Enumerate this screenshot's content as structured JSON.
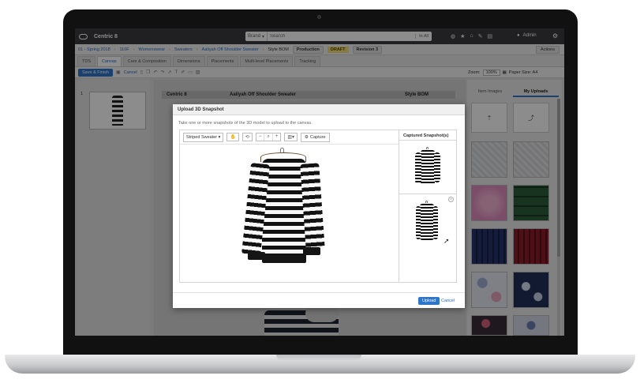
{
  "app": {
    "name": "Centric 8"
  },
  "search": {
    "brand_label": "Brand",
    "placeholder": "Search",
    "scope": "In All"
  },
  "user": {
    "name": "Admin"
  },
  "breadcrumb": {
    "items": [
      "01 - Spring 2018",
      "110F",
      "Womenswear",
      "Sweaters",
      "Aaliyah Off Shoulder Sweater"
    ],
    "page_label": "Style BOM",
    "status": "Production",
    "state": "DRAFT",
    "revision": "Revision 3",
    "actions": "Actions"
  },
  "tabs": [
    "TDS",
    "Canvas",
    "Care & Composition",
    "Dimensions",
    "Placements",
    "Multi-level Placements",
    "Tracking"
  ],
  "toolbar": {
    "save_finish": "Save & Finish",
    "cancel": "Cancel",
    "zoom_label": "Zoom:",
    "zoom_value": "100%",
    "paper_size": "Paper Size: A4"
  },
  "pages": {
    "page_number": "1"
  },
  "sheet": {
    "brand": "Centric 8",
    "style": "Aaliyah Off Shoulder Sweater",
    "doc": "Style BOM"
  },
  "right_panel": {
    "tab_images": "Item Images",
    "tab_uploads": "My Uploads",
    "upload_icons": [
      "upload-icon",
      "share-icon"
    ],
    "swatch_colors": [
      "#d7d8dc",
      "#d9d9dc",
      "#e59cc6",
      "#2f5e3c",
      "#26336e",
      "#8f1e2a",
      "#c9cfe3",
      "#22305c",
      "#3a2f39",
      "#d3d9e8"
    ]
  },
  "modal": {
    "title": "Upload 3D Snapshot",
    "instructions": "Take one or more snapshots of the 3D model to upload to the canvas.",
    "model_select": "Striped Sweater",
    "capture": "Capture",
    "captured_title": "Captured Snapshot(s)",
    "upload": "Upload",
    "cancel": "Cancel"
  },
  "colors": {
    "accent": "#2f75c9",
    "topbar": "#3b3b3f",
    "draft": "#f2e07a"
  }
}
